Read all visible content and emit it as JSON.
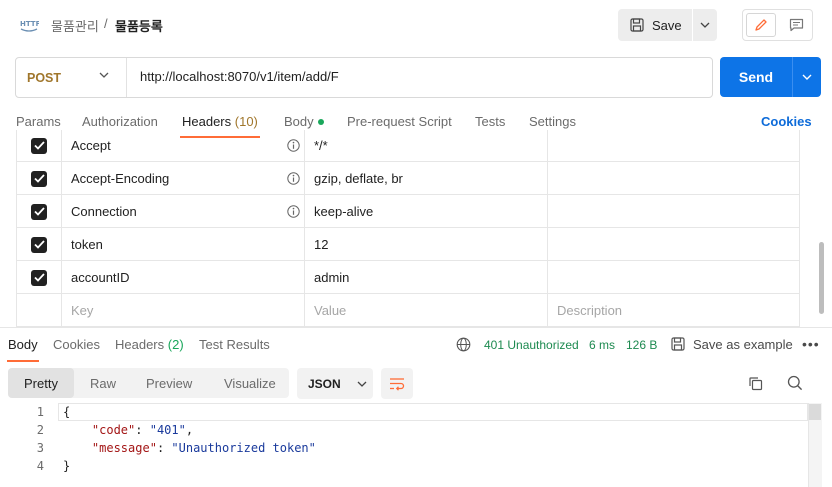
{
  "breadcrumb": {
    "parent": "물품관리",
    "separator": "/",
    "current": "물품등록"
  },
  "toolbar": {
    "save_label": "Save"
  },
  "request": {
    "method": "POST",
    "url": "http://localhost:8070/v1/item/add/F",
    "send_label": "Send"
  },
  "request_tabs": {
    "params": "Params",
    "authorization": "Authorization",
    "headers": "Headers",
    "headers_count": "(10)",
    "body": "Body",
    "prerequest": "Pre-request Script",
    "tests": "Tests",
    "settings": "Settings",
    "cookies": "Cookies"
  },
  "headers_table": {
    "rows": [
      {
        "key": "Accept",
        "value": "*/*",
        "info": true
      },
      {
        "key": "Accept-Encoding",
        "value": "gzip, deflate, br",
        "info": true
      },
      {
        "key": "Connection",
        "value": "keep-alive",
        "info": true
      },
      {
        "key": "token",
        "value": "12",
        "info": false
      },
      {
        "key": "accountID",
        "value": "admin",
        "info": false
      }
    ],
    "placeholder": {
      "key": "Key",
      "value": "Value",
      "description": "Description"
    }
  },
  "response_tabs": {
    "body": "Body",
    "cookies": "Cookies",
    "headers": "Headers",
    "headers_count": "(2)",
    "test_results": "Test Results"
  },
  "response_meta": {
    "status": "401 Unauthorized",
    "time": "6 ms",
    "size": "126 B",
    "save_example": "Save as example",
    "status_color": "#1d8a50"
  },
  "format": {
    "pretty": "Pretty",
    "raw": "Raw",
    "preview": "Preview",
    "visualize": "Visualize",
    "language": "JSON"
  },
  "code_lines": [
    {
      "num": "1",
      "parts": [
        {
          "t": "{",
          "c": "p"
        }
      ]
    },
    {
      "num": "2",
      "parts": [
        {
          "t": "    ",
          "c": "p"
        },
        {
          "t": "\"code\"",
          "c": "k"
        },
        {
          "t": ": ",
          "c": "p"
        },
        {
          "t": "\"401\"",
          "c": "s"
        },
        {
          "t": ",",
          "c": "p"
        }
      ]
    },
    {
      "num": "3",
      "parts": [
        {
          "t": "    ",
          "c": "p"
        },
        {
          "t": "\"message\"",
          "c": "k"
        },
        {
          "t": ": ",
          "c": "p"
        },
        {
          "t": "\"Unauthorized token\"",
          "c": "s"
        }
      ]
    },
    {
      "num": "4",
      "parts": [
        {
          "t": "}",
          "c": "p"
        }
      ]
    }
  ],
  "colors": {
    "accent": "#ff6c37",
    "send": "#0d74e7",
    "method": "#a0762b"
  }
}
